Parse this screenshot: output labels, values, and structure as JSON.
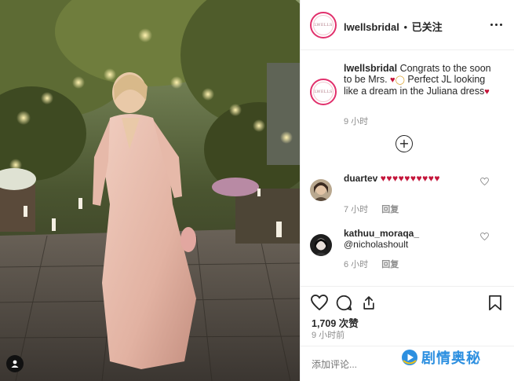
{
  "post": {
    "username": "lwellsbridal",
    "separator": "•",
    "follow_label": "已关注",
    "brand_avatar_text": "LWELLS",
    "caption": {
      "username": "lwellsbridal",
      "text_part1": "Congrats to the soon to be Mrs. ",
      "text_part2": " Perfect JL looking like a dream in the Juliana dress",
      "time": "9 小时"
    }
  },
  "comments": [
    {
      "username": "duartev",
      "text": "♥♥♥♥♥♥♥♥♥♥",
      "time": "7 小时",
      "reply_label": "回复"
    },
    {
      "username": "kathuu_moraqa_",
      "text": "@nicholashoult",
      "time": "6 小时",
      "reply_label": "回复"
    }
  ],
  "actions": {
    "likes": "1,709 次赞",
    "post_time": "9 小时前"
  },
  "composer": {
    "placeholder": "添加评论..."
  },
  "watermark": {
    "text": "剧情奥秘"
  },
  "icons": [
    "more-icon",
    "load-more-icon",
    "heart-icon",
    "comment-icon",
    "share-icon",
    "bookmark-icon",
    "tag-user-icon"
  ],
  "colors": {
    "accent_heart": "#c4153a",
    "brand_ring": "#e1306c",
    "meta_gray": "#8e8e8e",
    "watermark_blue": "#2c8fe0"
  }
}
